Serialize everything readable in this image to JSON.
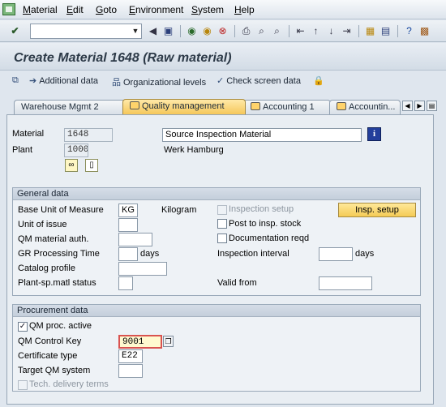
{
  "menu": [
    "Material",
    "Edit",
    "Goto",
    "Environment",
    "System",
    "Help"
  ],
  "toolbar": {
    "command_field_value": "",
    "icons": [
      "enter-icon",
      "back-icon",
      "save-icon",
      "exit-icon",
      "cancel-icon",
      "print-icon",
      "find-icon",
      "find-next-icon",
      "first-page-icon",
      "prev-page-icon",
      "next-page-icon",
      "last-page-icon",
      "new-session-icon",
      "shortcut-icon",
      "help-icon",
      "layout-menu-icon"
    ]
  },
  "title": "Create Material 1648 (Raw material)",
  "app_toolbar": {
    "additional_data": "Additional data",
    "org_levels": "Organizational levels",
    "check_screen": "Check screen data"
  },
  "tabs": [
    {
      "label": "Warehouse Mgmt 2"
    },
    {
      "label": "Quality management"
    },
    {
      "label": "Accounting 1"
    },
    {
      "label": "Accountin..."
    }
  ],
  "header": {
    "material_label": "Material",
    "material_value": "1648",
    "material_desc": "Source Inspection Material",
    "plant_label": "Plant",
    "plant_value": "1000",
    "plant_desc": "Werk Hamburg"
  },
  "general": {
    "title": "General data",
    "buom_label": "Base Unit of Measure",
    "buom_value": "KG",
    "buom_text": "Kilogram",
    "unit_issue_label": "Unit of issue",
    "unit_issue_value": "",
    "qm_auth_label": "QM material auth.",
    "qm_auth_value": "",
    "gr_time_label": "GR Processing Time",
    "gr_time_value": "",
    "gr_time_unit": "days",
    "catalog_label": "Catalog profile",
    "catalog_value": "",
    "plant_status_label": "Plant-sp.matl status",
    "plant_status_value": "",
    "insp_setup_check": "Inspection setup",
    "post_insp_check": "Post to insp. stock",
    "doc_reqd_check": "Documentation reqd",
    "insp_interval_label": "Inspection interval",
    "insp_interval_value": "",
    "insp_interval_unit": "days",
    "valid_from_label": "Valid from",
    "valid_from_value": "",
    "insp_setup_button": "Insp. setup"
  },
  "procurement": {
    "title": "Procurement data",
    "qm_proc_active": "QM proc. active",
    "qm_proc_checked": true,
    "qm_control_key_label": "QM Control Key",
    "qm_control_key_value": "9001",
    "cert_type_label": "Certificate type",
    "cert_type_value": "E22",
    "target_qm_label": "Target QM system",
    "target_qm_value": "",
    "tech_delivery": "Tech. delivery terms"
  }
}
